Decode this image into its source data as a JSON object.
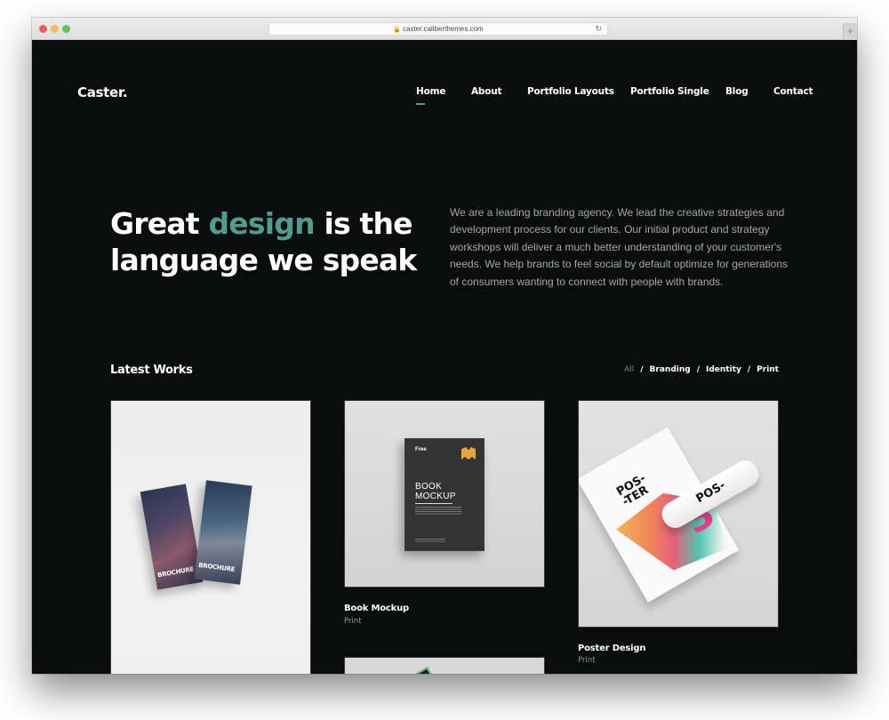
{
  "browser": {
    "url": "caster.caliberthemes.com",
    "lock_icon": "lock-icon",
    "reload_icon": "reload-icon",
    "new_tab_icon": "plus-icon"
  },
  "header": {
    "logo": "Caster.",
    "nav": [
      {
        "label": "Home",
        "active": true
      },
      {
        "label": "About",
        "active": false
      },
      {
        "label": "Portfolio Layouts",
        "active": false
      },
      {
        "label": "Portfolio Single",
        "active": false
      },
      {
        "label": "Blog",
        "active": false
      },
      {
        "label": "Contact",
        "active": false
      }
    ]
  },
  "hero": {
    "title_part1": "Great ",
    "title_accent": "design",
    "title_part2": " is the",
    "title_line2": "language we speak",
    "description": "We are a leading branding agency. We lead the creative strategies and development process for our clients. Our initial product and strategy workshops will deliver a much better understanding of your customer's needs. We help brands to feel social by default optimize for generations of consumers wanting to connect with people with brands."
  },
  "works": {
    "title": "Latest Works",
    "filters": [
      {
        "label": "All",
        "active": true
      },
      {
        "label": "Branding",
        "active": false
      },
      {
        "label": "Identity",
        "active": false
      },
      {
        "label": "Print",
        "active": false
      }
    ],
    "separator": "/",
    "items": [
      {
        "title": "",
        "category": "",
        "image": "brochure-mockup",
        "image_text": "BROCHURE"
      },
      {
        "title": "Book Mockup",
        "category": "Print",
        "image": "book-mockup",
        "image_text_free": "Free",
        "image_text": "BOOK MOCKUP"
      },
      {
        "title": "Poster Design",
        "category": "Print",
        "image": "poster-mockup",
        "image_text": "POS- -TER",
        "roll_text": "POS-",
        "big_glyph": "3"
      },
      {
        "title": "",
        "category": "",
        "image": "partial-mockup"
      }
    ]
  },
  "colors": {
    "accent": "#4f9d8c",
    "background": "#0b0c0c",
    "body_text": "#a6a6a6"
  }
}
